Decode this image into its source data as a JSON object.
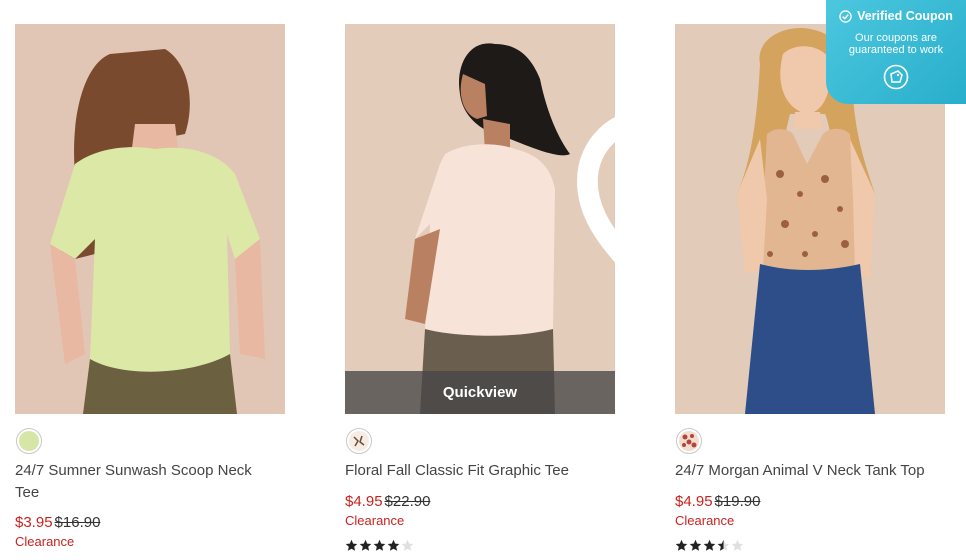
{
  "coupon": {
    "title": "Verified Coupon",
    "subtitle": "Our coupons are guaranteed to work",
    "accent": "#2fb4cf"
  },
  "products": [
    {
      "name": "24/7 Sumner Sunwash Scoop Neck Tee",
      "sale_price": "$3.95",
      "original_price": "$16.90",
      "badge": "Clearance",
      "swatch_color": "#d6e6a6",
      "rating": null
    },
    {
      "name": "Floral Fall Classic Fit Graphic Tee",
      "sale_price": "$4.95",
      "original_price": "$22.90",
      "badge": "Clearance",
      "swatch_color": "#f6ece4",
      "quickview_label": "Quickview",
      "rating": 4
    },
    {
      "name": "24/7 Morgan Animal V Neck Tank Top",
      "sale_price": "$4.95",
      "original_price": "$19.90",
      "badge": "Clearance",
      "swatch_color": "#c87a6a",
      "rating": 3.5
    }
  ],
  "colors": {
    "sale": "#c8231f",
    "star": "#222222",
    "star_empty": "#e0e0e0"
  }
}
